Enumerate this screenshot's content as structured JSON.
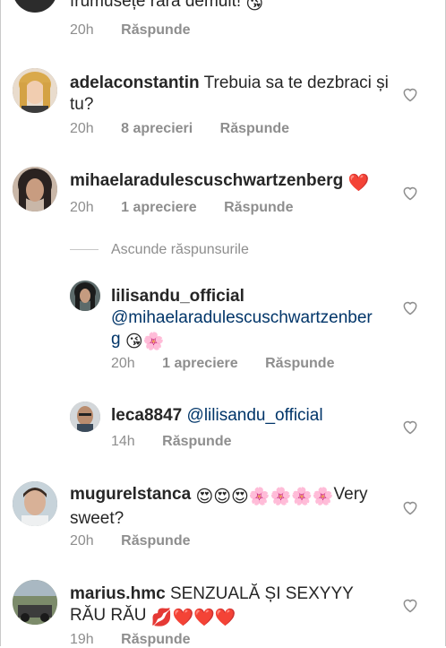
{
  "comments": [
    {
      "username": "",
      "text": "frumusețe rară demult!",
      "emoji": "😘",
      "time": "20h",
      "likes": "",
      "reply": "Răspunde"
    },
    {
      "username": "adelaconstantin",
      "text": "Trebuia sa te dezbraci și tu?",
      "time": "20h",
      "likes": "8 aprecieri",
      "reply": "Răspunde"
    },
    {
      "username": "mihaelaradulescuschwartzenberg",
      "emoji": "❤️",
      "time": "20h",
      "likes": "1 apreciere",
      "reply": "Răspunde"
    },
    {
      "username": "lilisandu_official",
      "mention": "@mihaelaradulescuschwartzenber",
      "mention_cont": "g",
      "emoji": "😘🌸",
      "time": "20h",
      "likes": "1 apreciere",
      "reply": "Răspunde"
    },
    {
      "username": "leca8847",
      "mention": "@lilisandu_official",
      "time": "14h",
      "reply": "Răspunde"
    },
    {
      "username": "mugurelstanca",
      "emoji": "😍😍😍🌸🌸🌸🌸",
      "text": "Very sweet?",
      "time": "20h",
      "reply": "Răspunde"
    },
    {
      "username": "marius.hmc",
      "text": "SENZUALĂ ȘI SEXYYY RĂU RĂU",
      "emoji": "💋❤️❤️❤️",
      "time": "19h",
      "reply": "Răspunde"
    }
  ],
  "hide_replies": "Ascunde răspunsurile",
  "icons": {
    "like": "heart-outline-icon"
  },
  "colors": {
    "text": "#262626",
    "meta": "#8e8e8e",
    "mention": "#003569",
    "heart_red": "#ed4956"
  }
}
